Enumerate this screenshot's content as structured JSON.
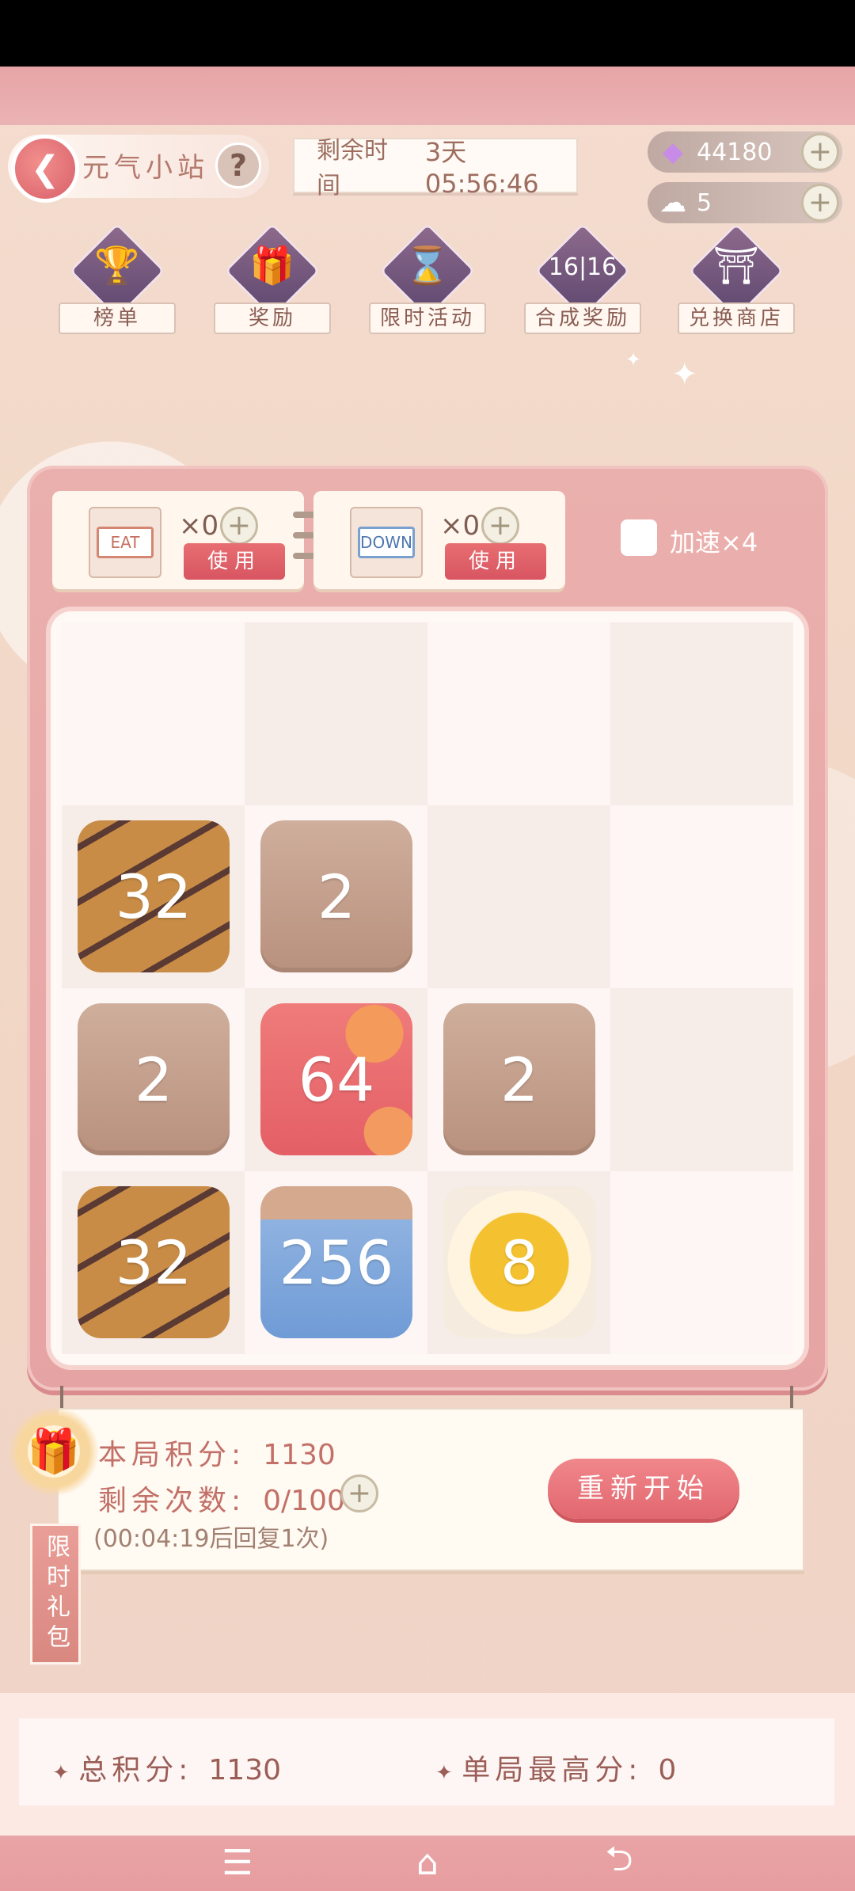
{
  "header": {
    "title": "元气小站",
    "help_label": "?",
    "timer_label": "剩余时间",
    "timer_value": "3天05:56:46",
    "gems": "44180",
    "chefs": "5"
  },
  "menu": [
    {
      "label": "榜单",
      "icon": "trophy-icon"
    },
    {
      "label": "奖励",
      "icon": "gift-icon"
    },
    {
      "label": "限时活动",
      "icon": "hourglass-icon"
    },
    {
      "label": "合成奖励",
      "icon": "merge-icon"
    },
    {
      "label": "兑换商店",
      "icon": "shop-icon"
    }
  ],
  "items": [
    {
      "sign": "EAT",
      "count": "×0",
      "use_label": "使用"
    },
    {
      "sign": "DOWN",
      "count": "×0",
      "use_label": "使用"
    }
  ],
  "speed_label": "加速×4",
  "board": {
    "tiles": [
      [
        null,
        null,
        null,
        null
      ],
      [
        32,
        2,
        null,
        null
      ],
      [
        2,
        64,
        2,
        null
      ],
      [
        32,
        256,
        8,
        null
      ]
    ],
    "tile_text": {
      "r1c0": "32",
      "r1c1": "2",
      "r2c0": "2",
      "r2c1": "64",
      "r2c2": "2",
      "r3c0": "32",
      "r3c1": "256",
      "r3c2": "8"
    }
  },
  "score": {
    "round_label": "本局积分:",
    "round_value": "1130",
    "remaining_label": "剩余次数:",
    "remaining_value": "0/100",
    "recover_note": "(00:04:19后回复1次)",
    "restart_label": "重新开始"
  },
  "gift_tab": "限时礼包",
  "footer": {
    "total_label": "总积分:",
    "total_value": "1130",
    "best_label": "单局最高分:",
    "best_value": "0"
  }
}
